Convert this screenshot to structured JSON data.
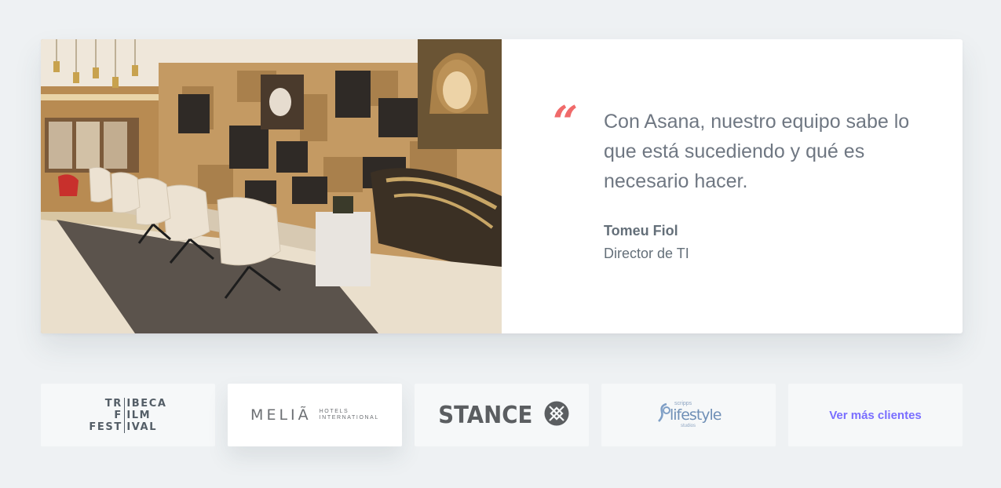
{
  "testimonial": {
    "quote_mark": "“",
    "quote": "Con Asana, nuestro equipo sabe lo que está sucediendo y qué es necesario hacer.",
    "author": "Tomeu Fiol",
    "role": "Director de TI",
    "accent_color": "#f06a6a"
  },
  "client_logos": {
    "tribeca": {
      "rows": [
        [
          "TR",
          "IBECA"
        ],
        [
          "F",
          "ILM"
        ],
        [
          "FEST",
          "IVAL"
        ]
      ]
    },
    "melia": {
      "main": "MELIÃ",
      "sub_line1": "HOTELS",
      "sub_line2": "INTERNATIONAL"
    },
    "stance": {
      "text": "STANCE",
      "icon": "stance-x-icon"
    },
    "lifestyle": {
      "top": "scripps",
      "main": "lifestyle",
      "bottom": "studios"
    },
    "more_link": {
      "label": "Ver más clientes",
      "color": "#796eff"
    }
  }
}
